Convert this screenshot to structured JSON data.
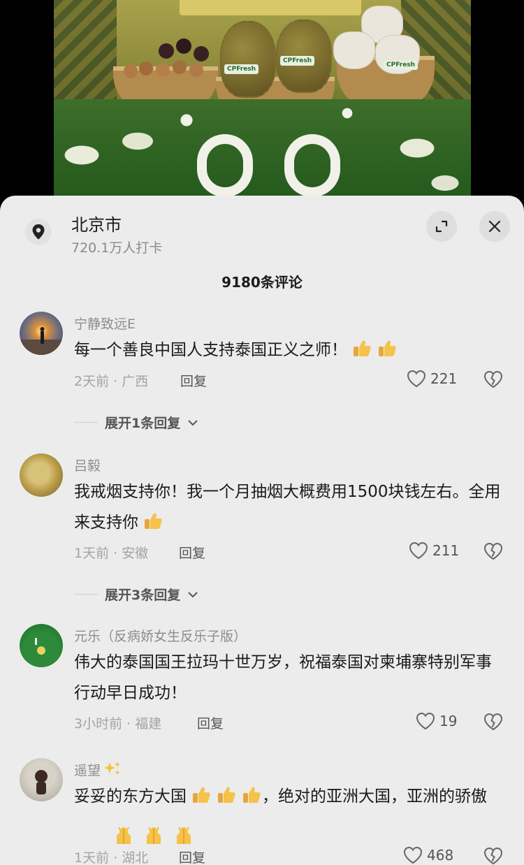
{
  "location": {
    "title": "北京市",
    "subtitle": "720.1万人打卡"
  },
  "comment_count": "9180条评论",
  "comments": [
    {
      "user": "宁静致远E",
      "text": "每一个善良中国人支持泰国正义之师！",
      "meta": "2天前 · 广西",
      "reply": "回复",
      "likes": "221",
      "expand": "展开1条回复"
    },
    {
      "user": "吕毅",
      "text": "我戒烟支持你！我一个月抽烟大概费用1500块钱左右。全用来支持你",
      "meta": "1天前 · 安徽",
      "reply": "回复",
      "likes": "211",
      "expand": "展开3条回复"
    },
    {
      "user": "元乐（反病娇女生反乐子版）",
      "text": "伟大的泰国国王拉玛十世万岁，祝福泰国对柬埔寨特别军事行动早日成功！",
      "meta": "3小时前 · 福建",
      "reply": "回复",
      "likes": "19"
    },
    {
      "user": "遥望",
      "text_a": "妥妥的东方大国",
      "text_b": "，绝对的亚洲大国，亚洲的骄傲",
      "meta": "1天前 · 湖北",
      "reply": "回复",
      "likes": "468"
    }
  ],
  "video_labels": [
    "CPFresh",
    "CPFresh",
    "CPFresh"
  ],
  "icons": {
    "location": "location-pin-icon",
    "expand": "expand-icon",
    "close": "close-icon",
    "like": "heart-icon",
    "dislike": "broken-heart-icon",
    "chevron": "chevron-down-icon",
    "thumbs_up": "thumbs-up-emoji",
    "wish": "wish-hands-emoji",
    "sparkle": "sparkle-icon"
  },
  "colors": {
    "sheet_bg": "#ececec",
    "text_primary": "#1a1a1a",
    "text_muted": "#8d8d8d"
  }
}
